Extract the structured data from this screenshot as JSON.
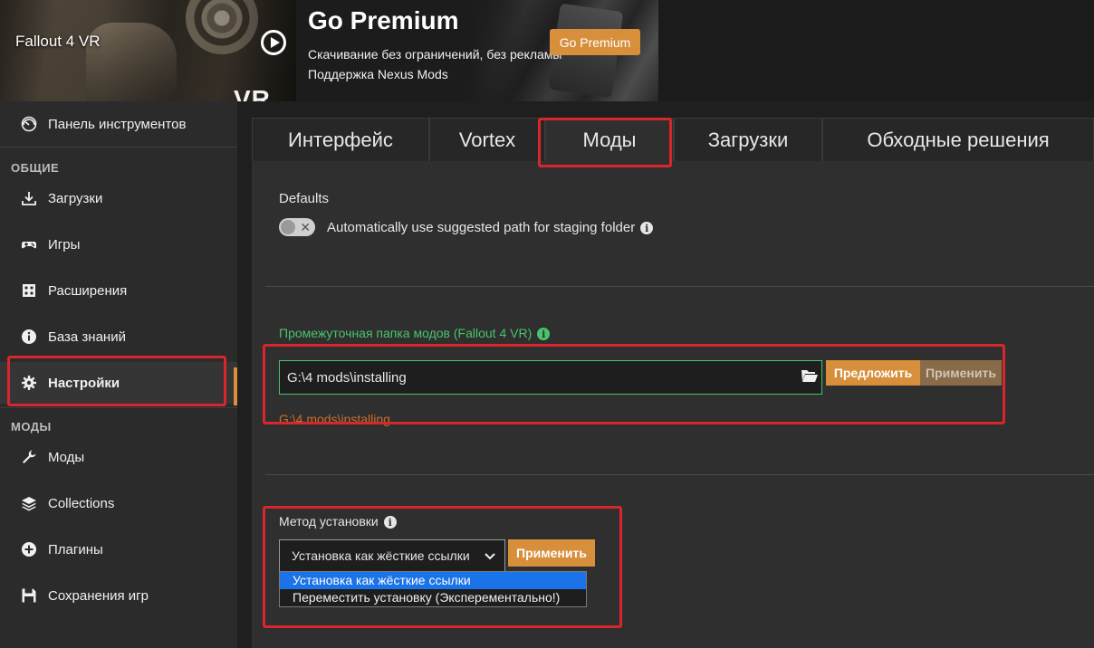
{
  "banner": {
    "game_title": "Fallout 4 VR",
    "game_art_deco": "VR",
    "premium_title": "Go Premium",
    "premium_line1": "Скачивание без ограничений, без рекламы",
    "premium_line2": "Поддержка Nexus Mods",
    "premium_button": "Go Premium"
  },
  "sidebar": {
    "dashboard": "Панель инструментов",
    "section_general": "ОБЩИЕ",
    "section_mods": "МОДЫ",
    "items": {
      "downloads": "Загрузки",
      "games": "Игры",
      "extensions": "Расширения",
      "knowledge": "База знаний",
      "settings": "Настройки",
      "mods": "Моды",
      "collections": "Collections",
      "plugins": "Плагины",
      "saves": "Сохранения игр"
    }
  },
  "tabs": {
    "interface": "Интерфейс",
    "vortex": "Vortex",
    "mods": "Моды",
    "downloads": "Загрузки",
    "workarounds": "Обходные решения"
  },
  "settings": {
    "defaults_label": "Defaults",
    "toggle_label": "Automatically use suggested path for staging folder",
    "staging_label": "Промежуточная папка модов (Fallout 4 VR)",
    "staging_path": "G:\\4 mods\\installing",
    "path_hint": "G:\\4 mods\\installing",
    "suggest_button": "Предложить",
    "apply_path_button": "Применить",
    "method_label": "Метод установки",
    "method_selected": "Установка как жёсткие ссылки",
    "method_apply_button": "Применить",
    "method_options": [
      "Установка как жёсткие ссылки",
      "Переместить установку (Эксперементально!)"
    ]
  },
  "colors": {
    "accent": "#d78f3b",
    "success": "#48c56a",
    "highlight": "#d8262b",
    "selection": "#1a73e8"
  },
  "icons": {
    "dashboard": "gauge-icon",
    "downloads": "download-icon",
    "games": "gamepad-icon",
    "extensions": "puzzle-icon",
    "knowledge": "info-icon",
    "settings": "gear-icon",
    "mods": "wrench-icon",
    "collections": "layers-icon",
    "plugins": "plus-circle-icon",
    "saves": "floppy-icon"
  }
}
